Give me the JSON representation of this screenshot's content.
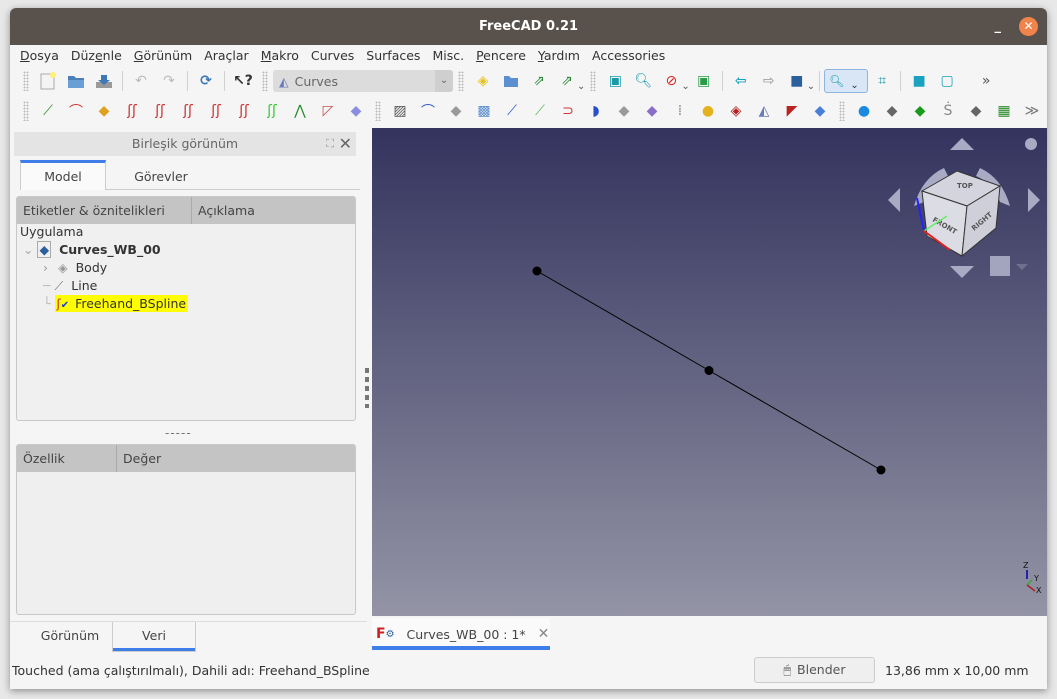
{
  "window": {
    "title": "FreeCAD 0.21"
  },
  "menu": [
    {
      "label": "Dosya",
      "u": "D",
      "rest": "osya"
    },
    {
      "label": "Düzenle",
      "pre": "Düz",
      "u": "e",
      "rest": "nle"
    },
    {
      "label": "Görünüm",
      "u": "G",
      "rest": "örünüm"
    },
    {
      "label": "Araçlar"
    },
    {
      "label": "Makro",
      "u": "M",
      "rest": "akro"
    },
    {
      "label": "Curves"
    },
    {
      "label": "Surfaces"
    },
    {
      "label": "Misc."
    },
    {
      "label": "Pencere",
      "u": "P",
      "rest": "encere"
    },
    {
      "label": "Yardım",
      "u": "Y",
      "rest": "ardım"
    },
    {
      "label": "Accessories"
    }
  ],
  "toolbar": {
    "workbench": "Curves",
    "overflow": "»"
  },
  "combo": {
    "title": "Birleşik görünüm",
    "tabs": [
      "Model",
      "Görevler"
    ],
    "active_tab": "Model"
  },
  "tree": {
    "headers": [
      "Etiketler & öznitelikleri",
      "Açıklama"
    ],
    "root": "Uygulama",
    "document": "Curves_WB_00",
    "items": [
      {
        "label": "Body",
        "icon": "body-icon",
        "expandable": true
      },
      {
        "label": "Line",
        "icon": "line-icon"
      },
      {
        "label": "Freehand_BSpline",
        "icon": "bspline-icon",
        "highlighted": true
      }
    ]
  },
  "splitter": "-----",
  "properties": {
    "headers": [
      "Özellik",
      "Değer"
    ],
    "tabs": [
      "Görünüm",
      "Veri"
    ],
    "active_tab": "Veri"
  },
  "viewport": {
    "points": [
      [
        0,
        0
      ],
      [
        1,
        1
      ],
      [
        2,
        2
      ]
    ],
    "navcube_faces": [
      "TOP",
      "FRONT",
      "RIGHT"
    ],
    "axes": [
      "Z",
      "Y",
      "X"
    ],
    "colors": {
      "bg_top": "#33335e",
      "bg_bottom": "#9494a6"
    }
  },
  "document_tab": {
    "label": "Curves_WB_00 : 1*"
  },
  "status": {
    "message": "Touched (ama çalıştırılmalı), Dahili adı: Freehand_BSpline",
    "nav_style": "Blender",
    "dimensions": "13,86 mm x 10,00 mm"
  }
}
